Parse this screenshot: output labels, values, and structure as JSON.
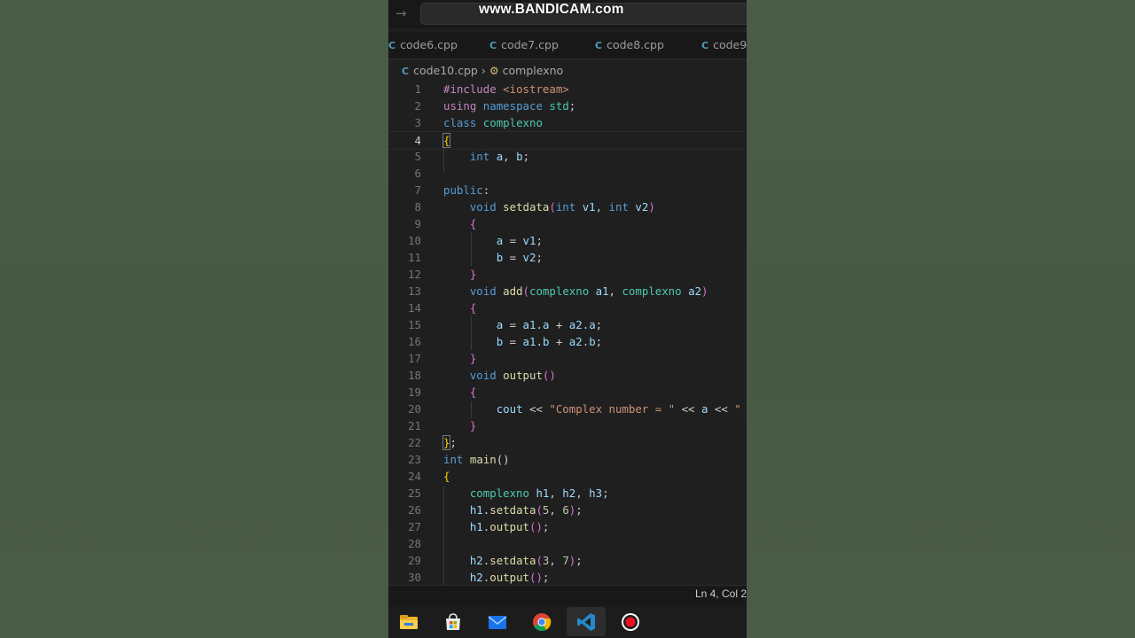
{
  "watermark": "www.BANDICAM.com",
  "tabs": [
    {
      "label": "code6.cpp"
    },
    {
      "label": "code7.cpp"
    },
    {
      "label": "code8.cpp"
    },
    {
      "label": "code9"
    }
  ],
  "breadcrumb": {
    "file": "code10.cpp",
    "symbol": "complexno"
  },
  "status": {
    "position": "Ln 4, Col 2"
  },
  "editor": {
    "current_line": 4,
    "line_numbers": [
      "1",
      "2",
      "3",
      "4",
      "5",
      "6",
      "7",
      "8",
      "9",
      "10",
      "11",
      "12",
      "13",
      "14",
      "15",
      "16",
      "17",
      "18",
      "19",
      "20",
      "21",
      "22",
      "23",
      "24",
      "25",
      "26",
      "27",
      "28",
      "29",
      "30"
    ]
  },
  "taskbar": {
    "items": [
      "file-explorer-icon",
      "microsoft-store-icon",
      "mail-icon",
      "chrome-icon",
      "vscode-icon",
      "record-icon"
    ]
  },
  "colors": {
    "keyword": "#569cd6",
    "type": "#4ec9b0",
    "function": "#dcdcaa",
    "variable": "#9cdcfe",
    "string": "#ce9178",
    "number": "#b5cea8",
    "control": "#c586c0"
  }
}
